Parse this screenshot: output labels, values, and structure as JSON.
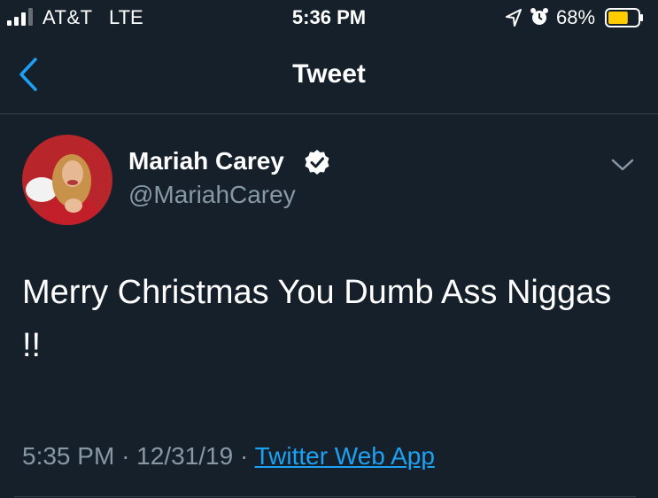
{
  "status_bar": {
    "carrier": "AT&T",
    "network": "LTE",
    "time": "5:36 PM",
    "battery_percent": "68%",
    "battery_level": 0.68,
    "battery_color": "#ffcc00",
    "icons": [
      "signal-bars-icon",
      "location-arrow-icon",
      "alarm-clock-icon",
      "battery-icon"
    ]
  },
  "nav": {
    "title": "Tweet",
    "back_icon": "chevron-left-icon"
  },
  "tweet": {
    "author_name": "Mariah Carey",
    "handle": "@MariahCarey",
    "verified_icon": "verified-badge-icon",
    "menu_icon": "chevron-down-icon",
    "text": "Merry Christmas You Dumb Ass Niggas !!",
    "time": "5:35 PM",
    "date": "12/31/19",
    "separator": "·",
    "source": "Twitter Web App"
  },
  "colors": {
    "background": "#15202b",
    "secondary_text": "#8899a6",
    "link": "#1da1f2",
    "accent": "#1da1f2",
    "verified_fill": "#ffffff"
  }
}
